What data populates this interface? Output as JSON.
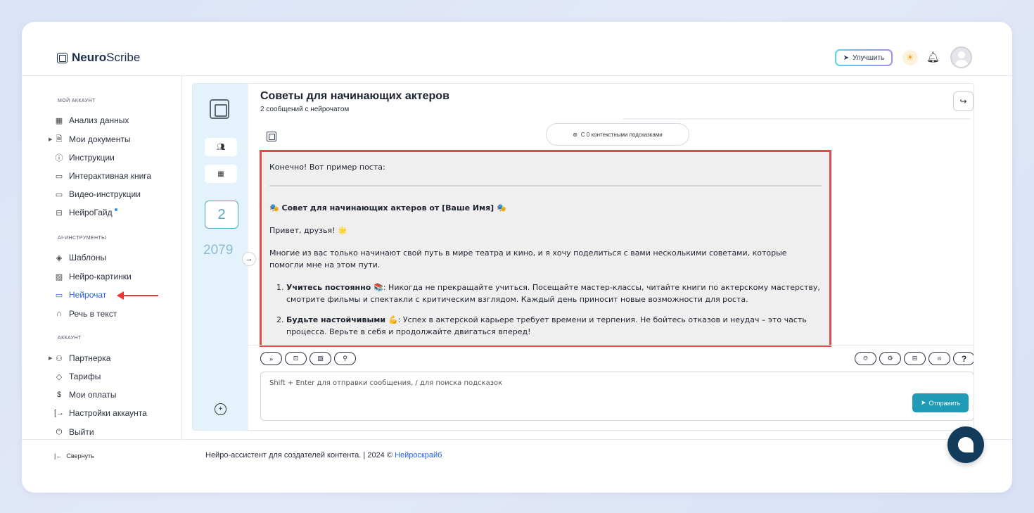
{
  "header": {
    "logo_bold": "Neuro",
    "logo_rest": "Scribe",
    "upgrade_label": "Улучшить"
  },
  "sidebar": {
    "sections": [
      {
        "title": "МОЙ АККАУНТ",
        "items": [
          {
            "label": "Анализ данных",
            "icon": "grid-icon"
          },
          {
            "label": "Мои документы",
            "icon": "document-icon"
          },
          {
            "label": "Инструкции",
            "icon": "help-circle-icon"
          },
          {
            "label": "Интерактивная книга",
            "icon": "book-icon"
          },
          {
            "label": "Видео-инструкции",
            "icon": "video-icon"
          },
          {
            "label": "НейроГайд",
            "icon": "guide-icon"
          }
        ]
      },
      {
        "title": "AI-ИНСТРУМЕНТЫ",
        "items": [
          {
            "label": "Шаблоны",
            "icon": "layers-icon"
          },
          {
            "label": "Нейро-картинки",
            "icon": "image-icon"
          },
          {
            "label": "Нейрочат",
            "icon": "chat-icon"
          },
          {
            "label": "Речь в текст",
            "icon": "headphones-icon"
          }
        ]
      },
      {
        "title": "АККАУНТ",
        "items": [
          {
            "label": "Партнерка",
            "icon": "users-icon"
          },
          {
            "label": "Тарифы",
            "icon": "tag-icon"
          },
          {
            "label": "Мои оплаты",
            "icon": "dollar-icon"
          },
          {
            "label": "Настройки аккаунта",
            "icon": "login-icon"
          },
          {
            "label": "Выйти",
            "icon": "power-icon"
          }
        ]
      }
    ],
    "collapse_label": "Свернуть"
  },
  "chat": {
    "rail_count": "2",
    "rail_number": "2079",
    "title": "Советы для начинающих актеров",
    "subtitle": "2 сообщений с нейрочатом",
    "context_pill": "С 0 контекстными подсказками",
    "message": {
      "intro": "Конечно! Вот пример поста:",
      "heading": "🎭 Совет для начинающих актеров от [Ваше Имя] 🎭",
      "greeting": "Привет, друзья! 🌟",
      "paragraph": "Многие из вас только начинают свой путь в мире театра и кино, и я хочу поделиться с вами несколькими советами, которые помогли мне на этом пути.",
      "tips": [
        {
          "bold": "Учитесь постоянно 📚",
          "text": ": Никогда не прекращайте учиться. Посещайте мастер-классы, читайте книги по актерскому мастерству, смотрите фильмы и спектакли с критическим взглядом. Каждый день приносит новые возможности для роста."
        },
        {
          "bold": "Будьте настойчивыми 💪",
          "text": ": Успех в актерской карьере требует времени и терпения. Не бойтесь отказов и неудач – это часть процесса. Верьте в себя и продолжайте двигаться вперед!"
        }
      ]
    },
    "input_placeholder": "Shift + Enter для отправки сообщения, / для поиска подсказок",
    "send_label": "Отправить"
  },
  "footer": {
    "text": "Нейро-ассистент для создателей контента.  | 2024 © ",
    "link": "Нейроскрайб"
  }
}
